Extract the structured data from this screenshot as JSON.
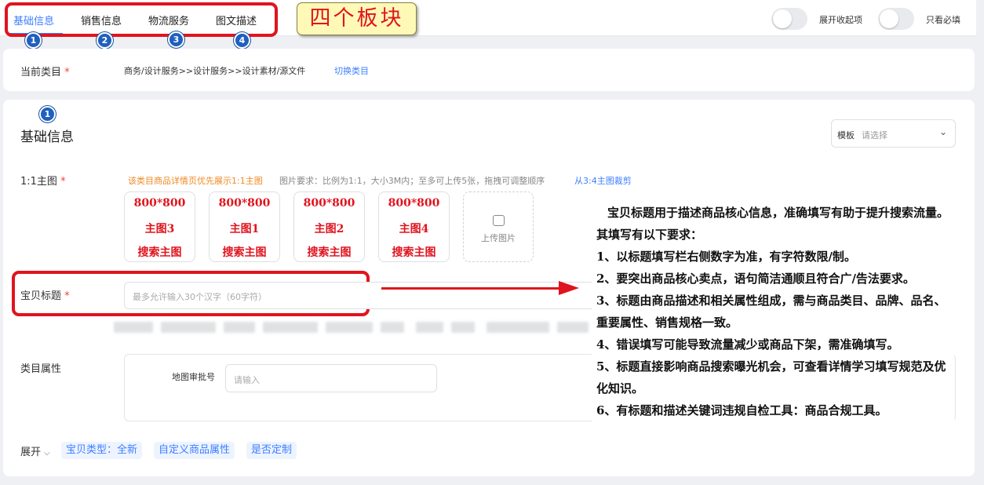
{
  "tabs": [
    {
      "label": "基础信息",
      "active": true,
      "badge": "1"
    },
    {
      "label": "销售信息",
      "active": false,
      "badge": "2"
    },
    {
      "label": "物流服务",
      "active": false,
      "badge": "3"
    },
    {
      "label": "图文描述",
      "active": false,
      "badge": "4"
    }
  ],
  "callout": "四个板块",
  "toggles": [
    {
      "label": "展开收起项",
      "on": false
    },
    {
      "label": "只看必填",
      "on": false
    }
  ],
  "category": {
    "label": "当前类目",
    "required_mark": "*",
    "path": "商务/设计服务>>设计服务>>设计素材/源文件",
    "switch_link": "切换类目"
  },
  "basic": {
    "badge": "1",
    "title": "基础信息",
    "template_label": "模板",
    "template_placeholder": "请选择",
    "main_image": {
      "label": "1:1主图",
      "hint_orange": "该类目商品详情页优先展示1:1主图",
      "hint_gray": "图片要求：比例为1:1，大小3M内；至多可上传5张，拖拽可调整顺序",
      "hint_link": "从3:4主图裁剪",
      "tiles": [
        {
          "size": "800*800",
          "name": "主图3",
          "tag": "搜索主图"
        },
        {
          "size": "800*800",
          "name": "主图1",
          "tag": "搜索主图"
        },
        {
          "size": "800*800",
          "name": "主图2",
          "tag": "搜索主图"
        },
        {
          "size": "800*800",
          "name": "主图4",
          "tag": "搜索主图"
        }
      ],
      "upload_label": "上传图片"
    },
    "title_field": {
      "label": "宝贝标题",
      "placeholder": "最多允许输入30个汉字（60字符）"
    },
    "attributes": {
      "label": "类目属性",
      "field_label": "地图审批号",
      "field_placeholder": "请输入"
    },
    "expand_label": "展开",
    "tags": [
      "宝贝类型：全新",
      "自定义商品属性",
      "是否定制"
    ]
  },
  "notes": [
    "宝贝标题用于描述商品核心信息，准确填写有助于提升搜索流量。其填写有以下要求：",
    "1、以标题填写栏右侧数字为准，有字符数限/制。",
    "2、要突出商品核心卖点，语句简洁通顺且符合广/告法要求。",
    "3、标题由商品描述和相关属性组成，需与商品类目、品牌、品名、重要属性、销售规格一致。",
    "4、错误填写可能导致流量减少或商品下架，需准确填写。",
    "5、标题直接影响商品搜索曝光机会，可查看详情学习填写规范及优化知识。",
    "6、有标题和描述关键词违规自检工具：商品合规工具。"
  ],
  "colors": {
    "accent": "#3d7fff",
    "annotation_red": "#e0141e",
    "badge_blue": "#1f5fbf"
  }
}
